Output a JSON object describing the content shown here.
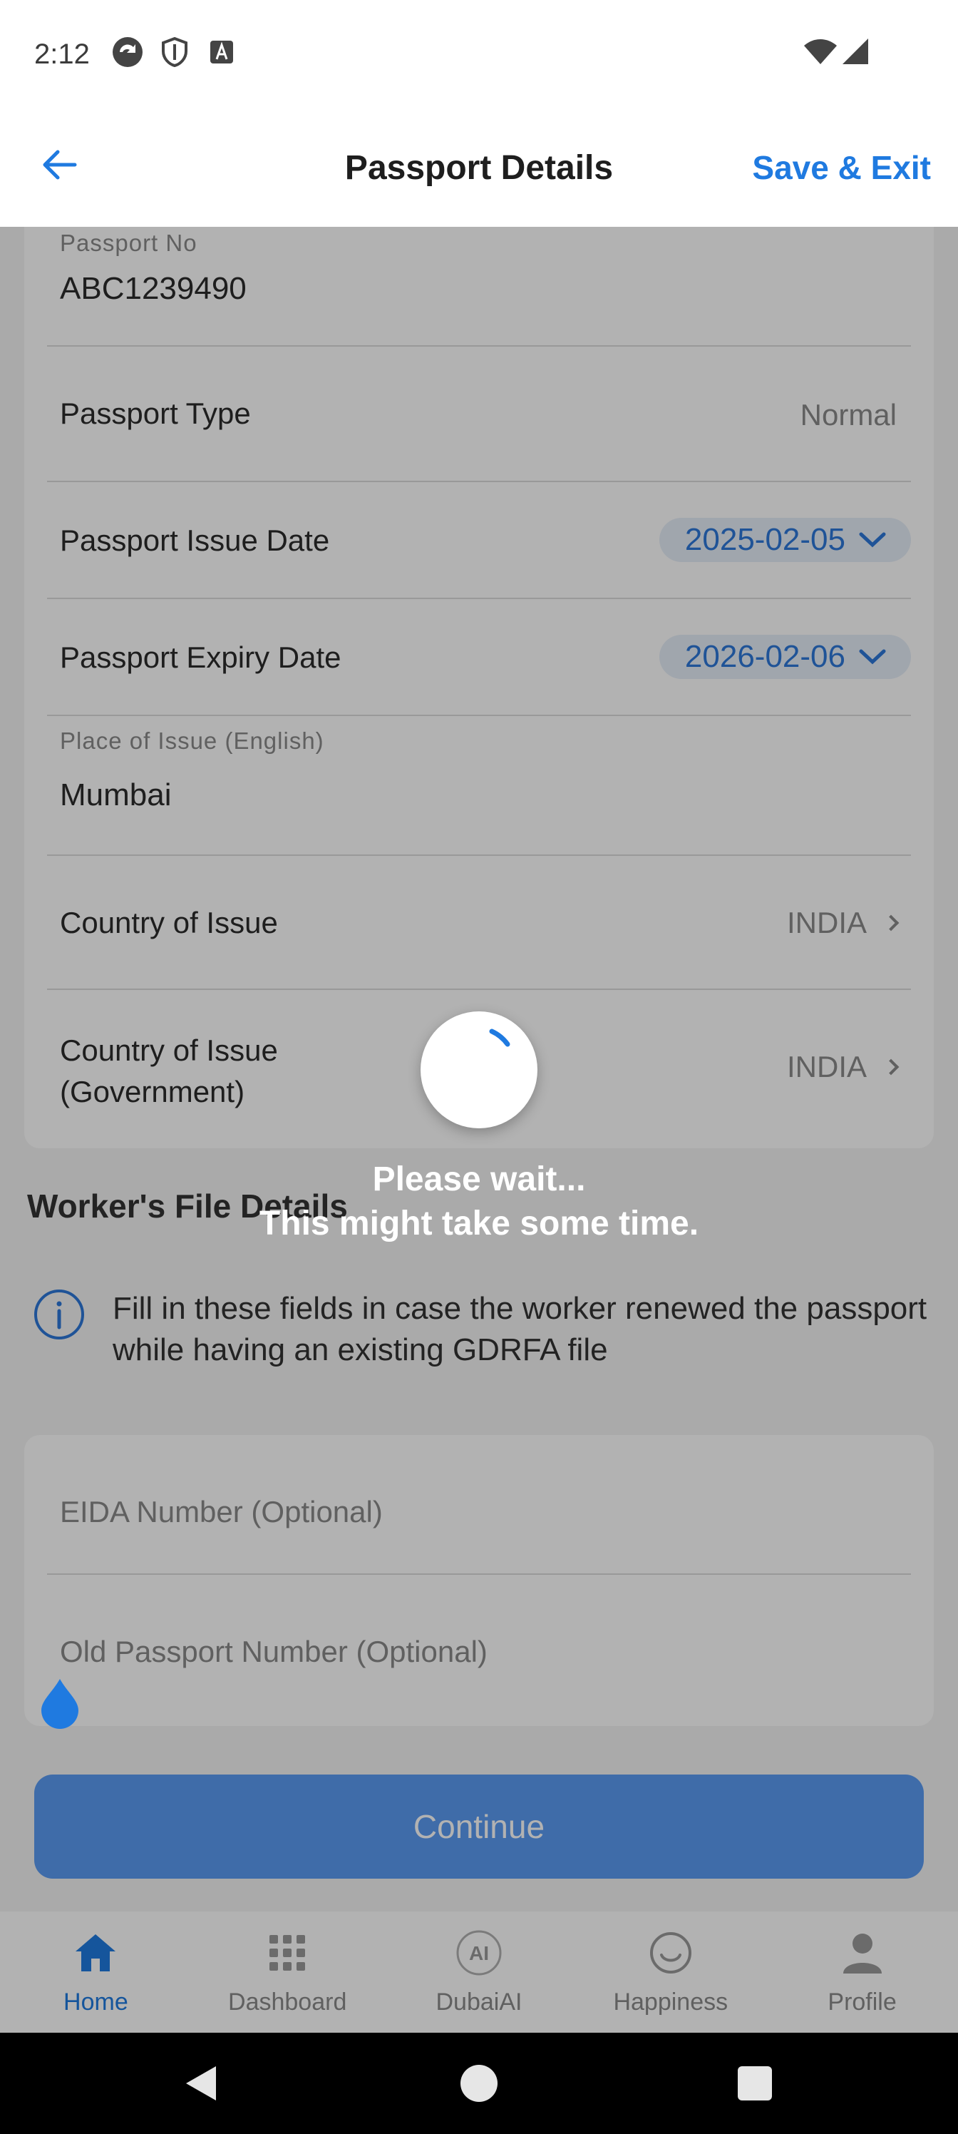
{
  "status_bar": {
    "time": "2:12",
    "icons": [
      "sync-icon",
      "shield-icon",
      "font-icon",
      "wifi-icon",
      "signal-icon"
    ]
  },
  "header": {
    "title": "Passport Details",
    "save_exit_label": "Save & Exit",
    "back_icon": "arrow-left-icon",
    "accent_color": "#1f7ae0"
  },
  "passport": {
    "passport_no_label": "Passport No",
    "passport_no_value": "ABC1239490",
    "passport_type_label": "Passport Type",
    "passport_type_value": "Normal",
    "issue_date_label": "Passport Issue Date",
    "issue_date_value": "2025-02-05",
    "expiry_date_label": "Passport Expiry Date",
    "expiry_date_value": "2026-02-06",
    "place_of_issue_label": "Place of Issue (English)",
    "place_of_issue_value": "Mumbai",
    "country_of_issue_label": "Country of Issue",
    "country_of_issue_value": "INDIA",
    "country_gov_label_line1": "Country of Issue",
    "country_gov_label_line2": "(Government)",
    "country_gov_value": "INDIA"
  },
  "worker_file": {
    "section_title": "Worker's File Details",
    "info_text": "Fill in these fields in case the worker renewed the passport while having an existing GDRFA file",
    "eida_placeholder": "EIDA Number (Optional)",
    "old_passport_placeholder": "Old Passport Number (Optional)"
  },
  "continue_label": "Continue",
  "loading": {
    "line1": "Please wait...",
    "line2": "This might take some time."
  },
  "bottom_nav": [
    {
      "label": "Home",
      "icon": "home-icon",
      "active": true
    },
    {
      "label": "Dashboard",
      "icon": "grid-icon",
      "active": false
    },
    {
      "label": "DubaiAI",
      "icon": "ai-icon",
      "active": false
    },
    {
      "label": "Happiness",
      "icon": "smiley-icon",
      "active": false
    },
    {
      "label": "Profile",
      "icon": "person-icon",
      "active": false
    }
  ],
  "system_nav": [
    "back-triangle-icon",
    "home-circle-icon",
    "recents-square-icon"
  ]
}
